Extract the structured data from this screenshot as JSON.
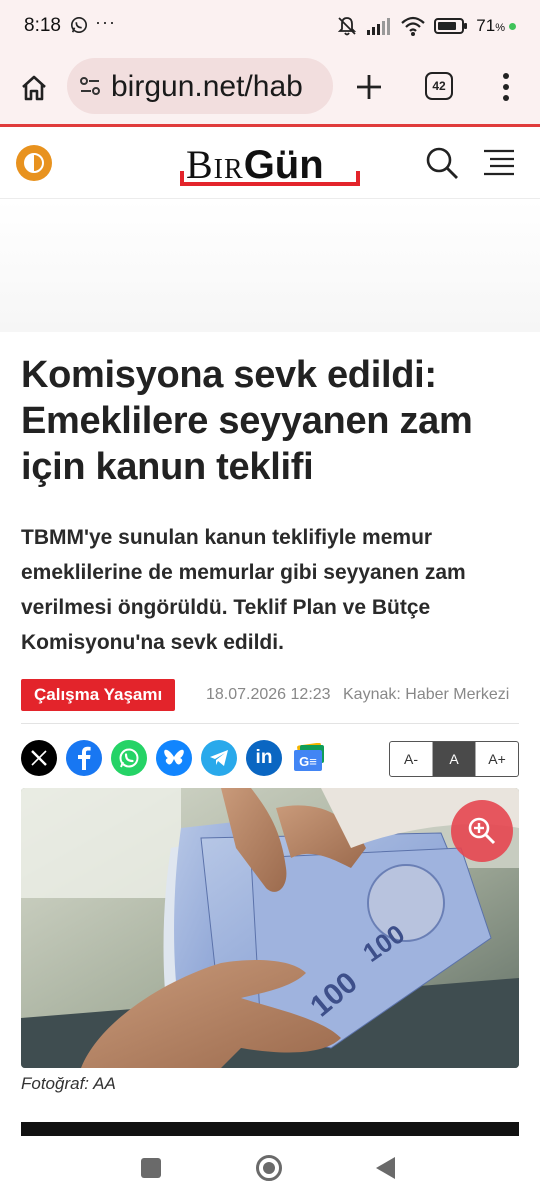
{
  "status": {
    "time": "8:18",
    "more": "···",
    "battery_pct": "71",
    "battery_unit": "%"
  },
  "browser": {
    "url": "birgun.net/hab",
    "tab_count": "42"
  },
  "site": {
    "logo_part1": "Bir",
    "logo_part2": "Gün"
  },
  "article": {
    "headline": "Komisyona sevk edildi: Emeklilere seyyanen zam için kanun teklifi",
    "summary": "TBMM'ye sunulan kanun teklifiyle memur emeklilerine de memurlar gibi seyyanen zam verilmesi öngörüldü. Teklif Plan ve Bütçe Komisyonu'na sevk edildi.",
    "category": "Çalışma Yaşamı",
    "date": "18.07.2026 12:23",
    "source": "Kaynak: Haber Merkezi",
    "photo_caption": "Fotoğraf: AA"
  },
  "font_sizes": {
    "smaller": "A-",
    "normal": "A",
    "larger": "A+"
  },
  "share": [
    {
      "name": "x-icon",
      "color": "#000000"
    },
    {
      "name": "facebook-icon",
      "color": "#1877f2"
    },
    {
      "name": "whatsapp-icon",
      "color": "#25d366"
    },
    {
      "name": "bluesky-icon",
      "color": "#1185fe"
    },
    {
      "name": "telegram-icon",
      "color": "#29a9eb"
    },
    {
      "name": "linkedin-icon",
      "color": "#0a66c2"
    },
    {
      "name": "google-news-icon",
      "color": "#4285f4"
    }
  ],
  "colors": {
    "brand_red": "#e3242b",
    "theme_orange": "#e8921e"
  }
}
